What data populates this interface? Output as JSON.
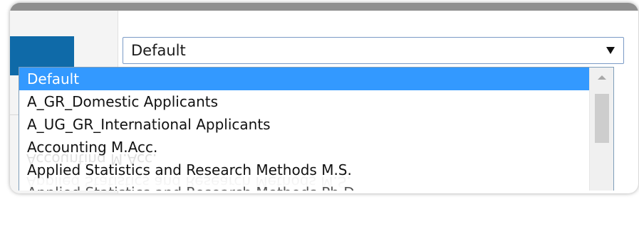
{
  "select": {
    "current_value": "Default",
    "options": [
      "Default",
      "A_GR_Domestic Applicants",
      "A_UG_GR_International Applicants",
      "Accounting M.Acc.",
      "Applied Statistics and Research Methods M.S.",
      "Applied Statistics and Research Methods Ph.D."
    ],
    "selected_index": 0
  },
  "reflection": {
    "lines": [
      "Applied Statistics and Research Methods M.S.",
      "Accounting M.Acc."
    ]
  },
  "colors": {
    "selected_bg": "#3399ff",
    "side_button": "#0f6aa8",
    "top_bar": "#8f8f8f"
  },
  "icons": {
    "select_arrow": "triangle-down-icon",
    "scroll_up": "triangle-up-icon"
  }
}
